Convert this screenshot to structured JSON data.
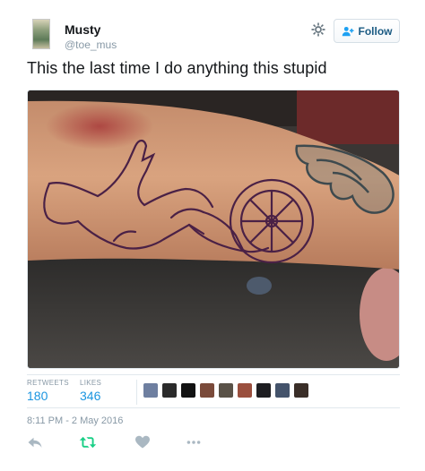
{
  "user": {
    "display_name": "Musty",
    "handle": "@toe_mus"
  },
  "follow_button": {
    "label": "Follow",
    "icon": "add-user-icon"
  },
  "settings_icon": "gear-icon",
  "tweet": {
    "text": "This the last time I do anything this stupid",
    "media": {
      "kind": "photo",
      "content": "forearm with a tattoo outline"
    }
  },
  "stats": {
    "retweets_label": "RETWEETS",
    "retweets_value": "180",
    "likes_label": "LIKES",
    "likes_value": "346",
    "liker_avatar_count": 9
  },
  "timestamp": "8:11 PM - 2 May 2016",
  "actions": [
    {
      "name": "reply",
      "icon": "reply-icon"
    },
    {
      "name": "retweet",
      "icon": "retweet-icon"
    },
    {
      "name": "like",
      "icon": "heart-icon"
    },
    {
      "name": "more",
      "icon": "more-dots-icon"
    }
  ],
  "colors": {
    "link_blue": "#1b95e0",
    "follow_text": "#1b5b83",
    "muted_gray": "#8899a6",
    "retweet_green": "#19cf86",
    "divider": "#e1e8ed"
  }
}
